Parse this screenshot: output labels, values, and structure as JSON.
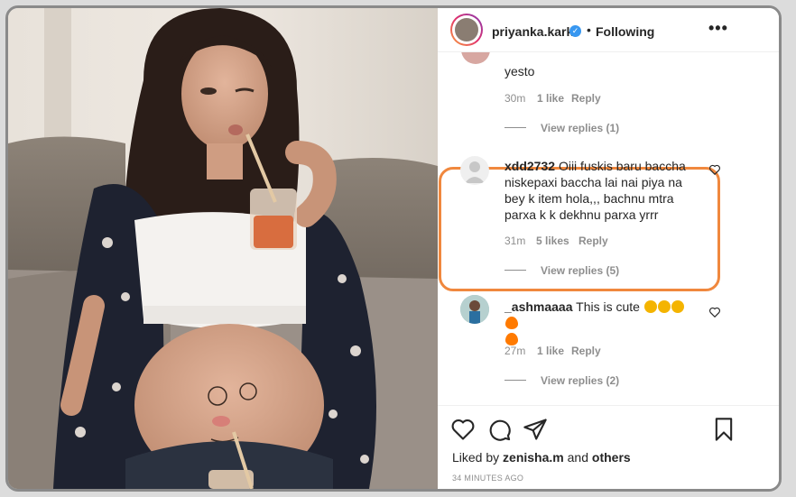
{
  "post": {
    "username": "priyanka.karki",
    "separator": "•",
    "follow_status": "Following",
    "more_label": "•••"
  },
  "comments": [
    {
      "text": "yesto",
      "time": "30m",
      "likes": "1 like",
      "reply": "Reply",
      "view_replies": "View replies (1)"
    },
    {
      "username": "xdd2732",
      "text_lines": [
        "Oiii fuskis baru baccha",
        "niskepaxi baccha lai nai piya na",
        "bey k item hola,,, bachnu mtra",
        "parxa k k dekhnu parxa yrrr"
      ],
      "time": "31m",
      "likes": "5 likes",
      "reply": "Reply",
      "view_replies": "View replies (5)"
    },
    {
      "username": "_ashmaaaa",
      "text": "This is cute",
      "time": "27m",
      "likes": "1 like",
      "reply": "Reply",
      "view_replies": "View replies (2)"
    }
  ],
  "footer": {
    "liked_prefix": "Liked by",
    "liked_user": "zenisha.m",
    "liked_and": "and",
    "liked_others": "others",
    "timestamp": "34 MINUTES AGO"
  },
  "icons": [
    "heart-icon",
    "comment-icon",
    "share-icon",
    "bookmark-icon",
    "verified-icon",
    "more-icon",
    "star-eyes-emoji-icon",
    "fire-emoji-icon"
  ],
  "colors": {
    "highlight": "#f0883e",
    "verified": "#3897f0",
    "muted": "#8e8e8e",
    "text": "#262626"
  }
}
